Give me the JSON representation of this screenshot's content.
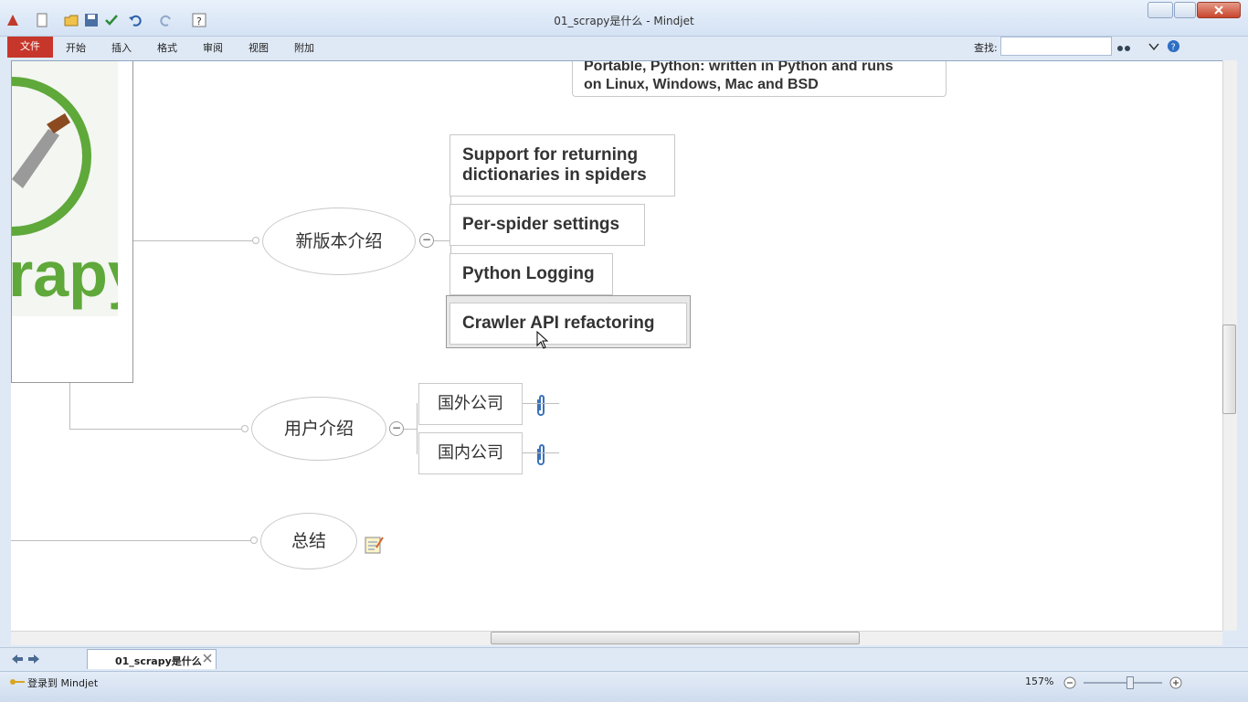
{
  "window": {
    "title": "01_scrapy是什么 - Mindjet"
  },
  "ribbon": {
    "tabs": [
      "文件",
      "开始",
      "插入",
      "格式",
      "审阅",
      "视图",
      "附加"
    ],
    "find_label": "查找:",
    "find_value": ""
  },
  "mindmap": {
    "top_note": {
      "line1": "Portable, Python:  written in Python and runs",
      "line2": "on Linux, Windows, Mac and BSD"
    },
    "logo_text": "rapy",
    "topic_new_version": {
      "label": "新版本介绍",
      "children": [
        "Support for returning dictionaries in spiders",
        "Per-spider settings",
        "Python Logging",
        "Crawler API refactoring"
      ]
    },
    "topic_users": {
      "label": "用户介绍",
      "children": [
        "国外公司",
        "国内公司"
      ]
    },
    "topic_summary": {
      "label": "总结"
    }
  },
  "doc_tab": {
    "label": "01_scrapy是什么"
  },
  "status": {
    "login": "登录到 Mindjet",
    "zoom": "157%"
  },
  "colors": {
    "accent_file_tab": "#c7362b",
    "logo_green": "#5fa83a"
  }
}
